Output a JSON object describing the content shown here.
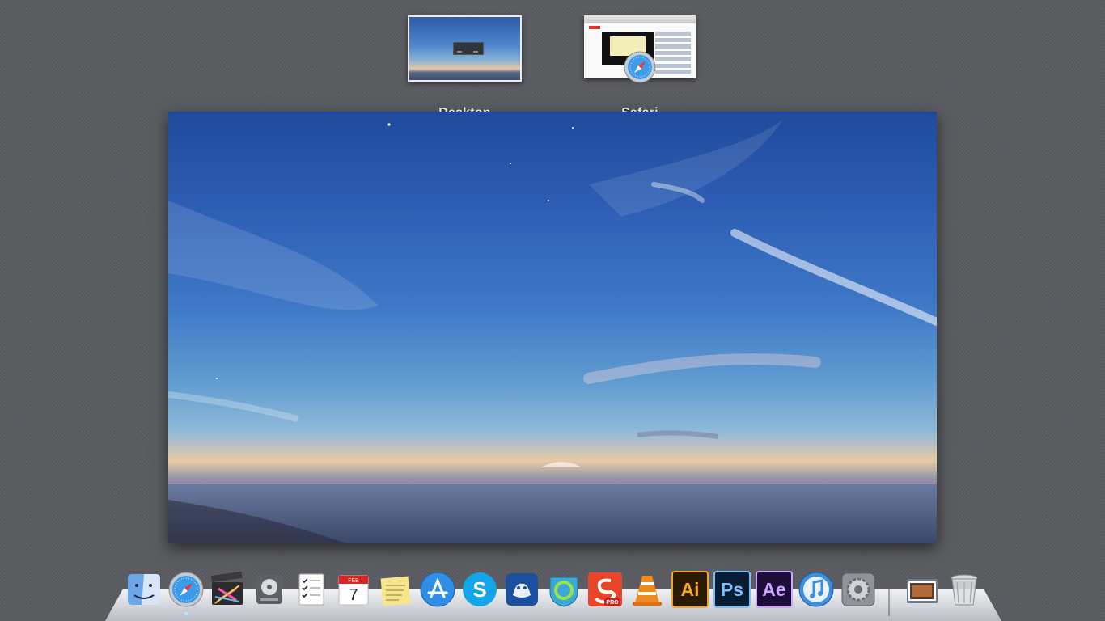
{
  "spaces": [
    {
      "id": "desktop",
      "label": "Desktop",
      "icon": "desktop-thumbnail"
    },
    {
      "id": "safari",
      "label": "Safari",
      "icon": "safari-icon"
    }
  ],
  "dock": {
    "apps": [
      {
        "name": "Finder",
        "icon": "finder-icon"
      },
      {
        "name": "Safari",
        "icon": "safari-icon",
        "running": true
      },
      {
        "name": "Final Cut Pro",
        "icon": "final-cut-pro-icon"
      },
      {
        "name": "Disk Utility",
        "icon": "disk-utility-icon"
      },
      {
        "name": "Reminders",
        "icon": "reminders-icon"
      },
      {
        "name": "Calendar",
        "icon": "calendar-icon",
        "month": "FEB",
        "day": "7"
      },
      {
        "name": "Stickies",
        "icon": "stickies-icon"
      },
      {
        "name": "App Store",
        "icon": "app-store-icon"
      },
      {
        "name": "Skype",
        "icon": "skype-icon",
        "letter": "S"
      },
      {
        "name": "Vuze",
        "icon": "vuze-icon"
      },
      {
        "name": "Camino",
        "icon": "camino-icon"
      },
      {
        "name": "SketchBook Pro",
        "icon": "sketchbook-pro-icon",
        "badge": "PRO"
      },
      {
        "name": "VLC",
        "icon": "vlc-icon"
      },
      {
        "name": "Adobe Illustrator",
        "icon": "illustrator-icon",
        "letters": "Ai"
      },
      {
        "name": "Adobe Photoshop",
        "icon": "photoshop-icon",
        "letters": "Ps"
      },
      {
        "name": "Adobe After Effects",
        "icon": "after-effects-icon",
        "letters": "Ae"
      },
      {
        "name": "iTunes",
        "icon": "itunes-icon"
      },
      {
        "name": "System Preferences",
        "icon": "system-preferences-icon"
      }
    ],
    "stacks": [
      {
        "name": "Photos Stack",
        "icon": "stack-folder-icon"
      },
      {
        "name": "Trash",
        "icon": "trash-icon"
      }
    ]
  },
  "colors": {
    "background": "#5a5c61",
    "dock_shelf": "#d8dbe0",
    "illustrator_bg": "#2b1b02",
    "illustrator_fg": "#f7a523",
    "photoshop_bg": "#071d35",
    "photoshop_fg": "#7ac1f4",
    "after_effects_bg": "#1c0d3b",
    "after_effects_fg": "#cfa6ff"
  }
}
